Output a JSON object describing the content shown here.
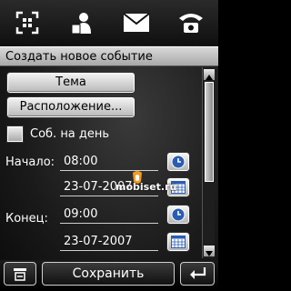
{
  "tabs": [
    {
      "icon": "scan-icon"
    },
    {
      "icon": "contacts-icon"
    },
    {
      "icon": "envelope-icon"
    },
    {
      "icon": "phone-icon"
    }
  ],
  "title": "Создать новое событие",
  "form": {
    "subject_label": "Тема",
    "location_label": "Расположение...",
    "all_day_label": "Соб. на день",
    "start_label": "Начало:",
    "start_time": "08:00",
    "start_date": "23-07-2007",
    "end_label": "Конец:",
    "end_time": "09:00",
    "end_date": "23-07-2007"
  },
  "watermark": "mobiset.ru",
  "bottom": {
    "save_label": "Сохранить"
  },
  "colors": {
    "accent_blue": "#2a5db0"
  }
}
